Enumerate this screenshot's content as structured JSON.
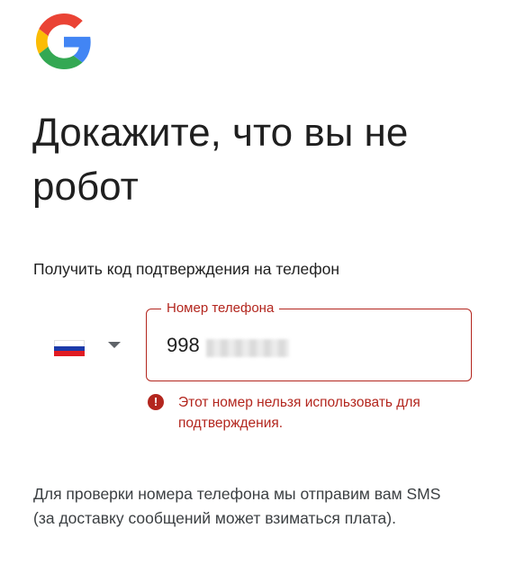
{
  "logo": {
    "icon": "google-g-icon",
    "colors": [
      "#4285F4",
      "#34A853",
      "#FBBC05",
      "#EA4335"
    ]
  },
  "title": "Докажите, что вы не робот",
  "subtitle": "Получить код подтверждения на телефон",
  "country": {
    "flag_icon": "russia-flag-icon",
    "dropdown_icon": "chevron-down-icon"
  },
  "phone": {
    "label": "Номер телефона",
    "value": "998"
  },
  "error": {
    "icon": "error-icon",
    "icon_glyph": "!",
    "message": "Этот номер нельзя использовать для подтверждения."
  },
  "footer": "Для проверки номера телефона мы отправим вам SMS (за доставку сообщений может взиматься плата).",
  "colors": {
    "error": "#b3261e",
    "text": "#1f1f1f"
  }
}
